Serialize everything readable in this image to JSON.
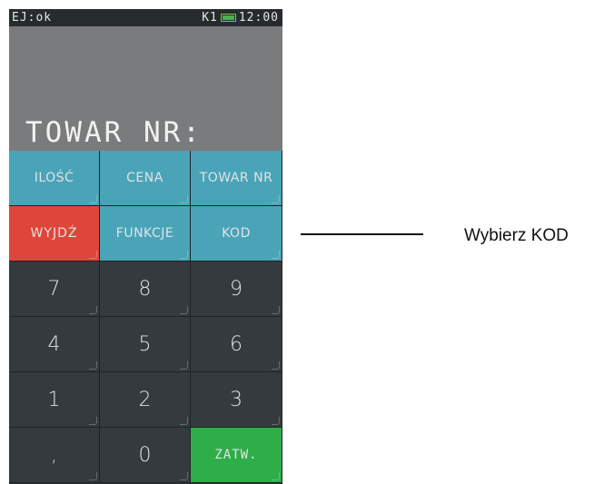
{
  "status_bar": {
    "left": "EJ:ok",
    "printer": "K1",
    "time": "12:00"
  },
  "display": {
    "prompt": "TOWAR NR:"
  },
  "keys": {
    "ilosc": "ILOŚĆ",
    "cena": "CENA",
    "towar_nr": "TOWAR NR",
    "wyjdz": "WYJDŹ",
    "funkcje": "FUNKCJE",
    "kod": "KOD",
    "k7": "7",
    "k8": "8",
    "k9": "9",
    "k4": "4",
    "k5": "5",
    "k6": "6",
    "k1": "1",
    "k2": "2",
    "k3": "3",
    "comma": ",",
    "k0": "0",
    "zatw": "ZATW."
  },
  "annotation": {
    "text": "Wybierz KOD"
  },
  "colors": {
    "func_key": "#4aa4b8",
    "exit_key": "#e0453a",
    "confirm_key": "#2eae48",
    "num_key": "#343a3d",
    "display": "#7a7b7c"
  }
}
